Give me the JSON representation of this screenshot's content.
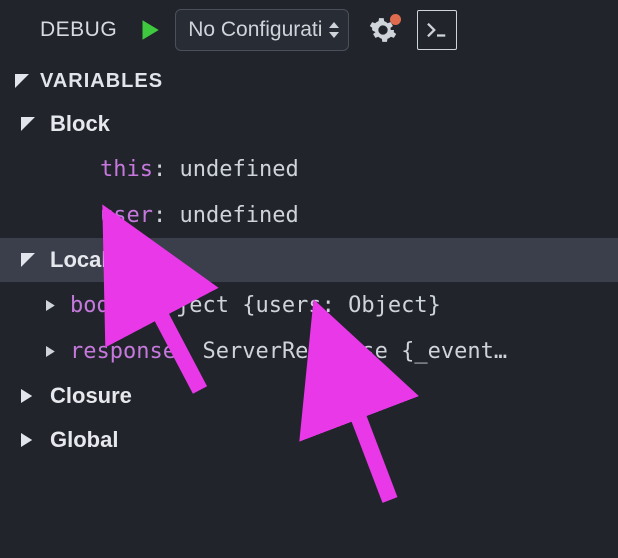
{
  "topbar": {
    "debug_label": "DEBUG",
    "config_selected": "No Configurati"
  },
  "section_title": "VARIABLES",
  "scopes": [
    {
      "name": "Block",
      "expanded": true,
      "selected": false,
      "vars": [
        {
          "name": "this",
          "value": "undefined",
          "expandable": false
        },
        {
          "name": "user",
          "value": "undefined",
          "expandable": false
        }
      ]
    },
    {
      "name": "Local",
      "expanded": true,
      "selected": true,
      "vars": [
        {
          "name": "body",
          "value": "Object {users: Object}",
          "expandable": true
        },
        {
          "name": "response",
          "value": "ServerResponse {_event…",
          "expandable": true
        }
      ]
    },
    {
      "name": "Closure",
      "expanded": false,
      "selected": false,
      "vars": []
    },
    {
      "name": "Global",
      "expanded": false,
      "selected": false,
      "vars": []
    }
  ]
}
